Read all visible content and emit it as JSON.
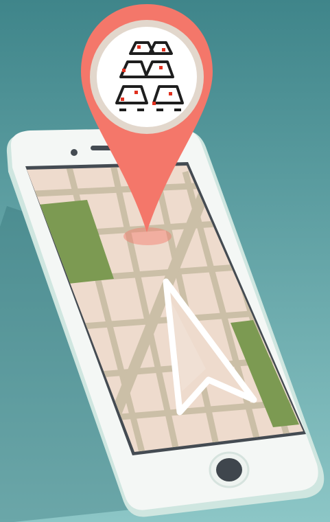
{
  "colors": {
    "bg_top": "#3f858a",
    "bg_bottom": "#8cc6c6",
    "phone_body": "#f4f7f5",
    "phone_edge": "#cfe6e0",
    "screen_bezel": "#444b52",
    "map_block": "#eedbcd",
    "map_road": "#cbbfa7",
    "park": "#7c9a52",
    "pin": "#f4776a",
    "pin_ring": "#e2d7cc",
    "arrow": "#ffffff",
    "home_button": "#3f464d"
  },
  "icons": {
    "pin": "location-pin-icon",
    "navigation": "navigation-arrow-icon",
    "logo": "cars-logo-icon"
  }
}
